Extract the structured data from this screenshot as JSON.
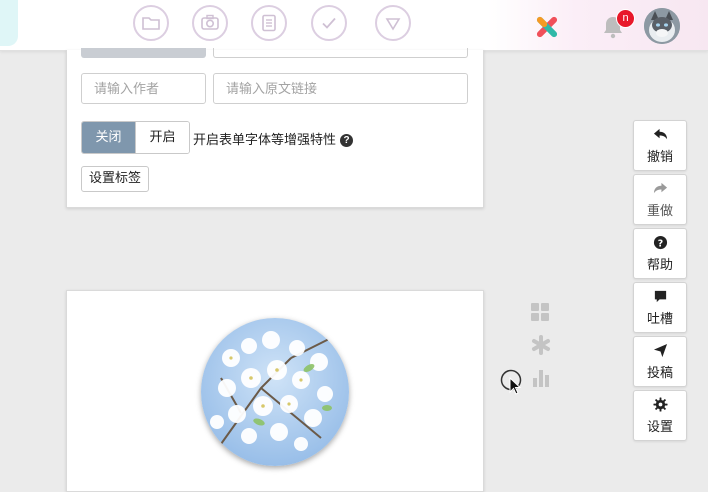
{
  "toolbar": {
    "icons": [
      "folder-icon",
      "camera-icon",
      "document-icon",
      "check-icon",
      "dropdown-triangle-icon"
    ],
    "notification_count": "n"
  },
  "form": {
    "author_placeholder": "请输入作者",
    "source_link_placeholder": "请输入原文链接",
    "toggle_off_label": "关闭",
    "toggle_on_label": "开启",
    "toggle_selected": "关闭",
    "toggle_description": "开启表单字体等增强特性",
    "set_tags_button": "设置标签"
  },
  "side_actions": [
    {
      "icon": "undo-arrow-icon",
      "label": "撤销"
    },
    {
      "icon": "redo-arrow-icon",
      "label": "重做"
    },
    {
      "icon": "question-circle-icon",
      "label": "帮助"
    },
    {
      "icon": "speech-bubble-icon",
      "label": "吐槽"
    },
    {
      "icon": "paper-plane-icon",
      "label": "投稿"
    },
    {
      "icon": "gear-icon",
      "label": "设置"
    }
  ],
  "floating_icons": [
    "grid-icon",
    "asterisk-icon",
    "bar-chart-icon"
  ],
  "colors": {
    "toggle_active": "#7f97ad",
    "badge": "#e8182a",
    "page_background": "#ebebeb"
  }
}
